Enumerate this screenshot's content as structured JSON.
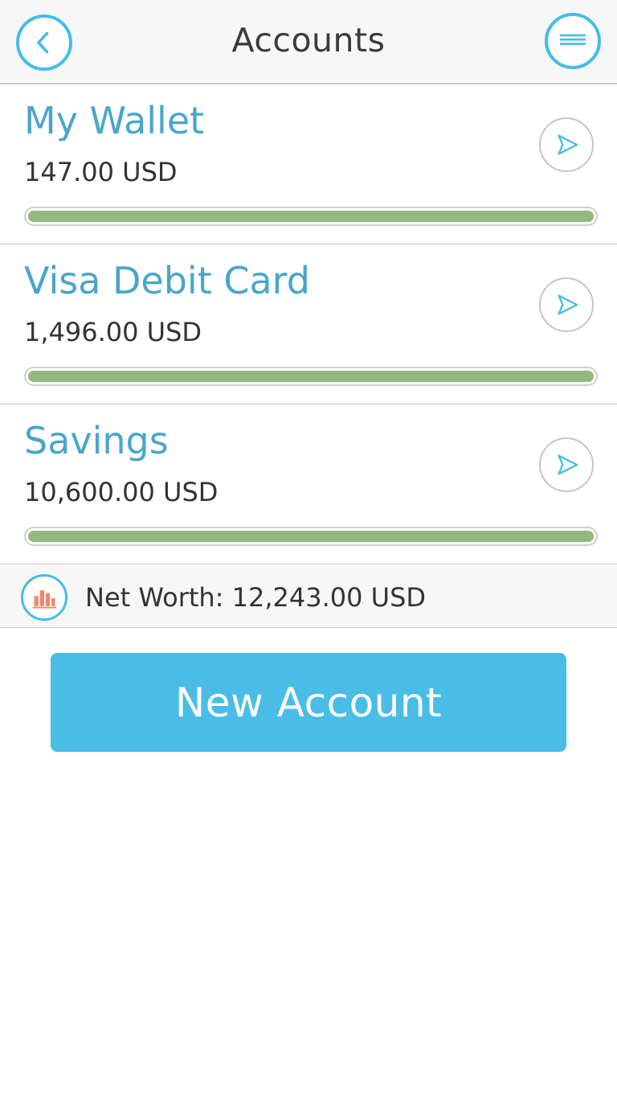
{
  "header": {
    "title": "Accounts",
    "back_icon": "chevron-left-icon",
    "menu_icon": "menu-icon"
  },
  "accounts": [
    {
      "name": "My Wallet",
      "balance": "147.00 USD",
      "progress": 1.0
    },
    {
      "name": "Visa Debit Card",
      "balance": "1,496.00 USD",
      "progress": 1.0
    },
    {
      "name": "Savings",
      "balance": "10,600.00 USD",
      "progress": 1.0
    }
  ],
  "net_worth": {
    "text": "Net Worth: 12,243.00 USD",
    "icon": "bar-chart-icon"
  },
  "new_account_label": "New Account",
  "colors": {
    "accent": "#45bde6",
    "button": "#4abde6",
    "account_name": "#4aa5cb",
    "progress_fill": "#93b97d",
    "chart_icon": "#f2876f"
  }
}
